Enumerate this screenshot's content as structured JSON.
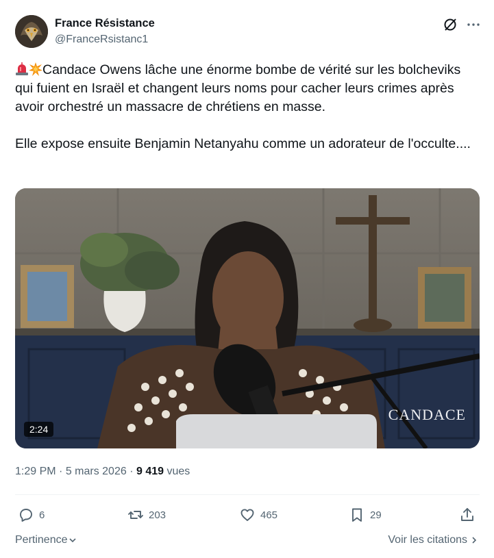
{
  "author": {
    "name": "France Résistance",
    "handle": "@FranceRsistanc1"
  },
  "tweet": {
    "paragraph1": "Candace Owens lâche une énorme bombe de vérité sur les bolcheviks qui fuient en Israël et changent leurs noms pour cacher leurs crimes après avoir orchestré un massacre de chrétiens en masse.",
    "paragraph2": "Elle expose ensuite  Benjamin Netanyahu comme un adorateur de l'occulte....",
    "emojis": [
      "rotating-light-icon",
      "collision-icon"
    ]
  },
  "video": {
    "duration": "2:24",
    "watermark": "CANDACE"
  },
  "meta": {
    "time": "1:29 PM",
    "separator1": " · ",
    "date": "5 mars 2026",
    "separator2": " · ",
    "views_count": "9 419",
    "views_label": " vues"
  },
  "actions": {
    "replies": "6",
    "reposts": "203",
    "likes": "465",
    "bookmarks": "29"
  },
  "footer": {
    "sort_label": "Pertinence",
    "quotes_label": "Voir les citations"
  },
  "colors": {
    "text": "#0f1419",
    "secondary": "#536471",
    "divider": "#eff3f4"
  }
}
